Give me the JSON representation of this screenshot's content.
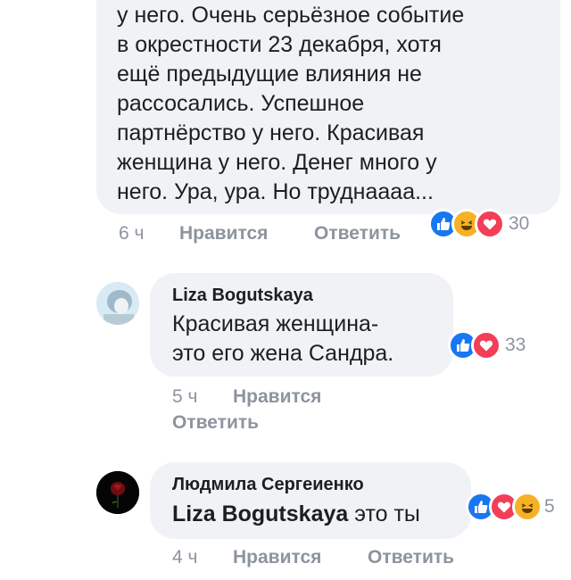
{
  "comment1": {
    "lines": [
      "у него. Очень серьёзное событие",
      "в окрестности 23 декабря, хотя",
      "ещё предыдущие влияния не",
      "рассосались. Успешное",
      "партнёрство у него. Красивая",
      "женщина у него. Денег много у",
      "него. Ура, ура. Но труднаааа..."
    ],
    "time": "6 ч",
    "like_label": "Нравится",
    "reply_label": "Ответить",
    "reaction_count": "30",
    "reactions": [
      "like-icon",
      "haha-icon",
      "love-icon"
    ]
  },
  "comment2": {
    "author": "Liza Bogutskaya",
    "lines": [
      "Красивая женщина-",
      "это его жена Сандра."
    ],
    "time": "5 ч",
    "like_label": "Нравится",
    "reply_label": "Ответить",
    "reaction_count": "33",
    "reactions": [
      "like-icon",
      "love-icon"
    ]
  },
  "comment3": {
    "author": "Людмила Сергеиенко",
    "mention": "Liza Bogutskaya",
    "text": "это ты",
    "time": "4 ч",
    "like_label": "Нравится",
    "reply_label": "Ответить",
    "reaction_count": "5",
    "reactions": [
      "like-icon",
      "love-icon",
      "haha-icon"
    ]
  },
  "colors": {
    "bubble": "#f0f2f5",
    "meta": "#8d949e",
    "like": "#1877f2",
    "love": "#f33e58",
    "haha": "#f7b125"
  }
}
